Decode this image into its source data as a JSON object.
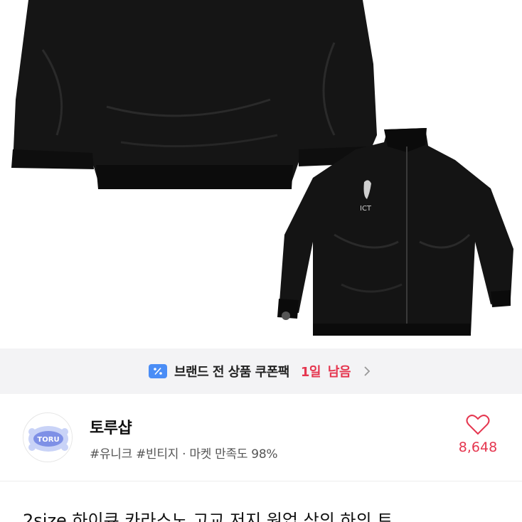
{
  "coupon": {
    "label": "브랜드 전 상품 쿠폰팩",
    "days": "1일",
    "remaining": "남음",
    "icon": "coupon-percent-icon",
    "accent": "#4a8df6",
    "highlight": "#e5364f"
  },
  "shop": {
    "name": "토루샵",
    "tags": "#유니크 #빈티지",
    "separator": "·",
    "satisfaction_label": "마켓 만족도",
    "satisfaction_value": "98%",
    "avatar_text": "TORU",
    "like_icon": "heart-icon",
    "like_count": "8,648"
  },
  "product": {
    "title": "2size 하이큐 카라스노 고교 저지 원업 상의 하의 트"
  },
  "colors": {
    "banner_bg": "#f3f3f5",
    "like": "#e5364f"
  }
}
